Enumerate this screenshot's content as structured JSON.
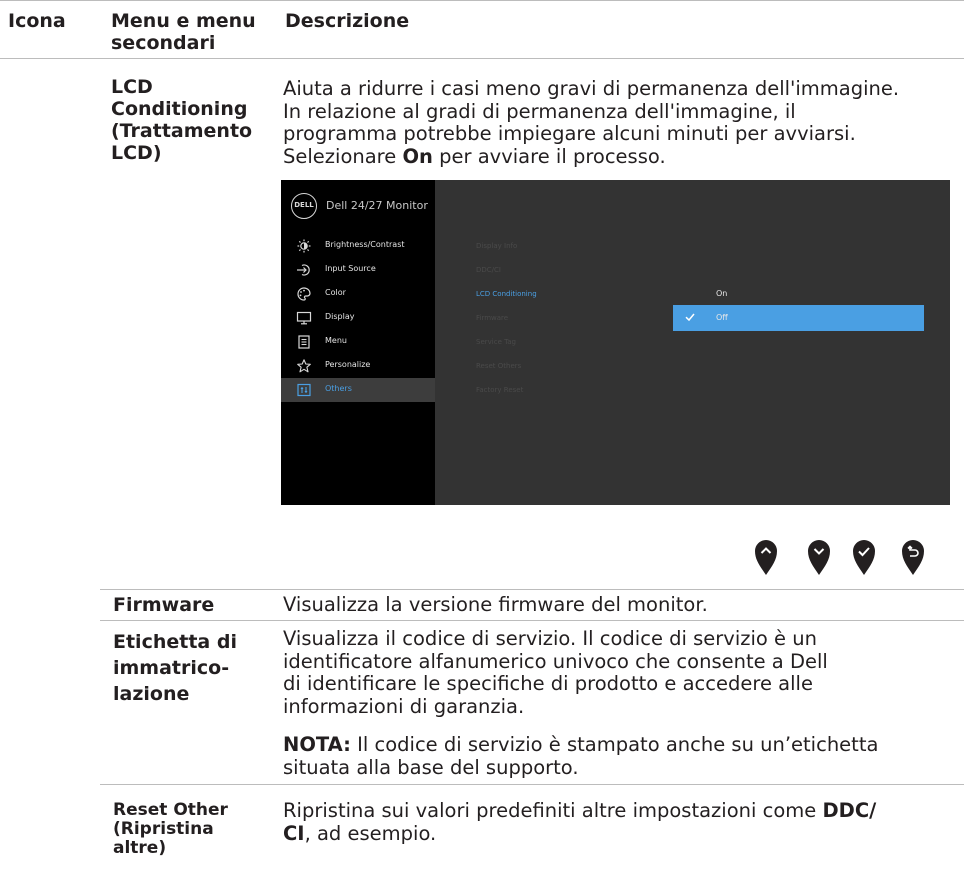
{
  "header": {
    "col_icon": "Icona",
    "col_menu_line1": "Menu e menu",
    "col_menu_line2": "secondari",
    "col_desc": "Descrizione"
  },
  "rows": {
    "lcd": {
      "label_lines": [
        "LCD",
        "Conditioning",
        "(Trattamento",
        "LCD)"
      ],
      "desc_lines": [
        "Aiuta a ridurre i casi meno gravi di permanenza dell'immagine.",
        "In relazione al gradi di permanenza dell'immagine, il",
        "programma potrebbe impiegare alcuni minuti per avviarsi."
      ],
      "desc_pre": "Selezionare ",
      "desc_bold": "On",
      "desc_post": " per avviare il processo."
    },
    "firmware": {
      "label": "Firmware",
      "desc": "Visualizza la versione firmware del monitor."
    },
    "service_tag": {
      "label_lines": [
        "Etichetta di",
        "immatrico-",
        "lazione"
      ],
      "desc_lines": [
        "Visualizza il codice di servizio. Il codice di servizio è un",
        "identificatore alfanumerico univoco che consente a Dell",
        "di identificare le specifiche di prodotto e accedere alle",
        "informazioni di garanzia."
      ],
      "note_bold": "NOTA:",
      "note_line1": " Il codice di servizio è stampato anche su un’etichetta",
      "note_line2": "situata alla base del supporto."
    },
    "reset_other": {
      "label_lines": [
        "Reset Other",
        "(Ripristina",
        "altre)"
      ],
      "desc_pre": "Ripristina sui valori predefiniti altre impostazioni come ",
      "desc_bold1": "DDC/",
      "desc_bold2": "CI",
      "desc_post": ", ad esempio."
    }
  },
  "osd": {
    "logo": "DELL",
    "title": "Dell 24/27 Monitor",
    "menu": [
      {
        "label": "Brightness/Contrast",
        "icon": "brightness-icon"
      },
      {
        "label": "Input Source",
        "icon": "input-source-icon"
      },
      {
        "label": "Color",
        "icon": "color-palette-icon"
      },
      {
        "label": "Display",
        "icon": "display-icon"
      },
      {
        "label": "Menu",
        "icon": "menu-icon"
      },
      {
        "label": "Personalize",
        "icon": "star-icon"
      },
      {
        "label": "Others",
        "icon": "others-icon",
        "active": true
      }
    ],
    "submenu": [
      "Display Info",
      "DDC/CI",
      "LCD Conditioning",
      "Firmware",
      "Service Tag",
      "Reset Others",
      "Factory Reset"
    ],
    "submenu_selected": "LCD Conditioning",
    "options": [
      {
        "label": "On",
        "selected": false
      },
      {
        "label": "Off",
        "selected": true
      }
    ],
    "accent_color": "#4a9fe3"
  },
  "nav_buttons": [
    "up-button-icon",
    "down-button-icon",
    "confirm-button-icon",
    "back-button-icon"
  ]
}
